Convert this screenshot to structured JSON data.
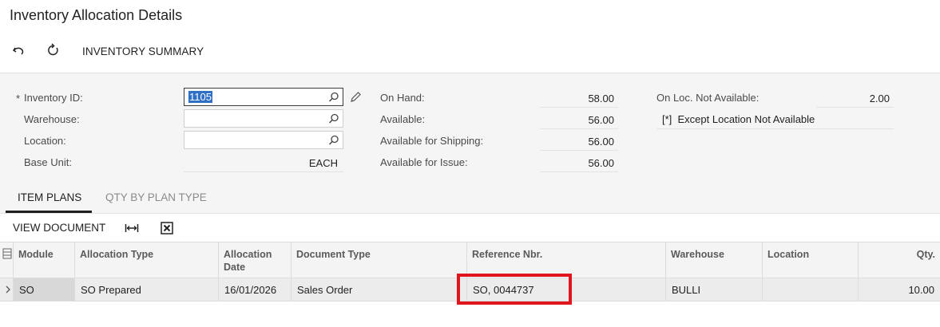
{
  "page": {
    "title": "Inventory Allocation Details"
  },
  "toolbar": {
    "undo_icon": "undo-icon",
    "refresh_icon": "refresh-icon",
    "summary_label": "INVENTORY SUMMARY"
  },
  "form": {
    "required_mark": "*",
    "inventory_id": {
      "label": "Inventory ID:",
      "value": "1105"
    },
    "warehouse": {
      "label": "Warehouse:",
      "value": ""
    },
    "location": {
      "label": "Location:",
      "value": ""
    },
    "base_unit": {
      "label": "Base Unit:",
      "value": "EACH"
    },
    "on_hand": {
      "label": "On Hand:",
      "value": "58.00"
    },
    "available": {
      "label": "Available:",
      "value": "56.00"
    },
    "available_shipping": {
      "label": "Available for Shipping:",
      "value": "56.00"
    },
    "available_issue": {
      "label": "Available for Issue:",
      "value": "56.00"
    },
    "on_loc_not_available": {
      "label": "On Loc. Not Available:",
      "value": "2.00"
    },
    "except_location": {
      "label": "[*]  Except Location Not Available"
    }
  },
  "tabs": [
    {
      "label": "ITEM PLANS",
      "active": true
    },
    {
      "label": "QTY BY PLAN TYPE",
      "active": false
    }
  ],
  "grid_toolbar": {
    "view_document": "VIEW DOCUMENT",
    "fit_icon": "fit-columns-icon",
    "export_icon": "excel-export-icon"
  },
  "grid": {
    "columns": [
      "Module",
      "Allocation Type",
      "Allocation Date",
      "Document Type",
      "Reference Nbr.",
      "Warehouse",
      "Location",
      "Qty."
    ],
    "rows": [
      {
        "module": "SO",
        "allocation_type": "SO Prepared",
        "allocation_date": "16/01/2026",
        "document_type": "Sales Order",
        "reference_nbr": "SO, 0044737",
        "warehouse": "BULLI",
        "location": "",
        "qty": "10.00"
      }
    ]
  },
  "colors": {
    "highlight_box": "#e0161c",
    "selection": "#2f6fc4"
  }
}
